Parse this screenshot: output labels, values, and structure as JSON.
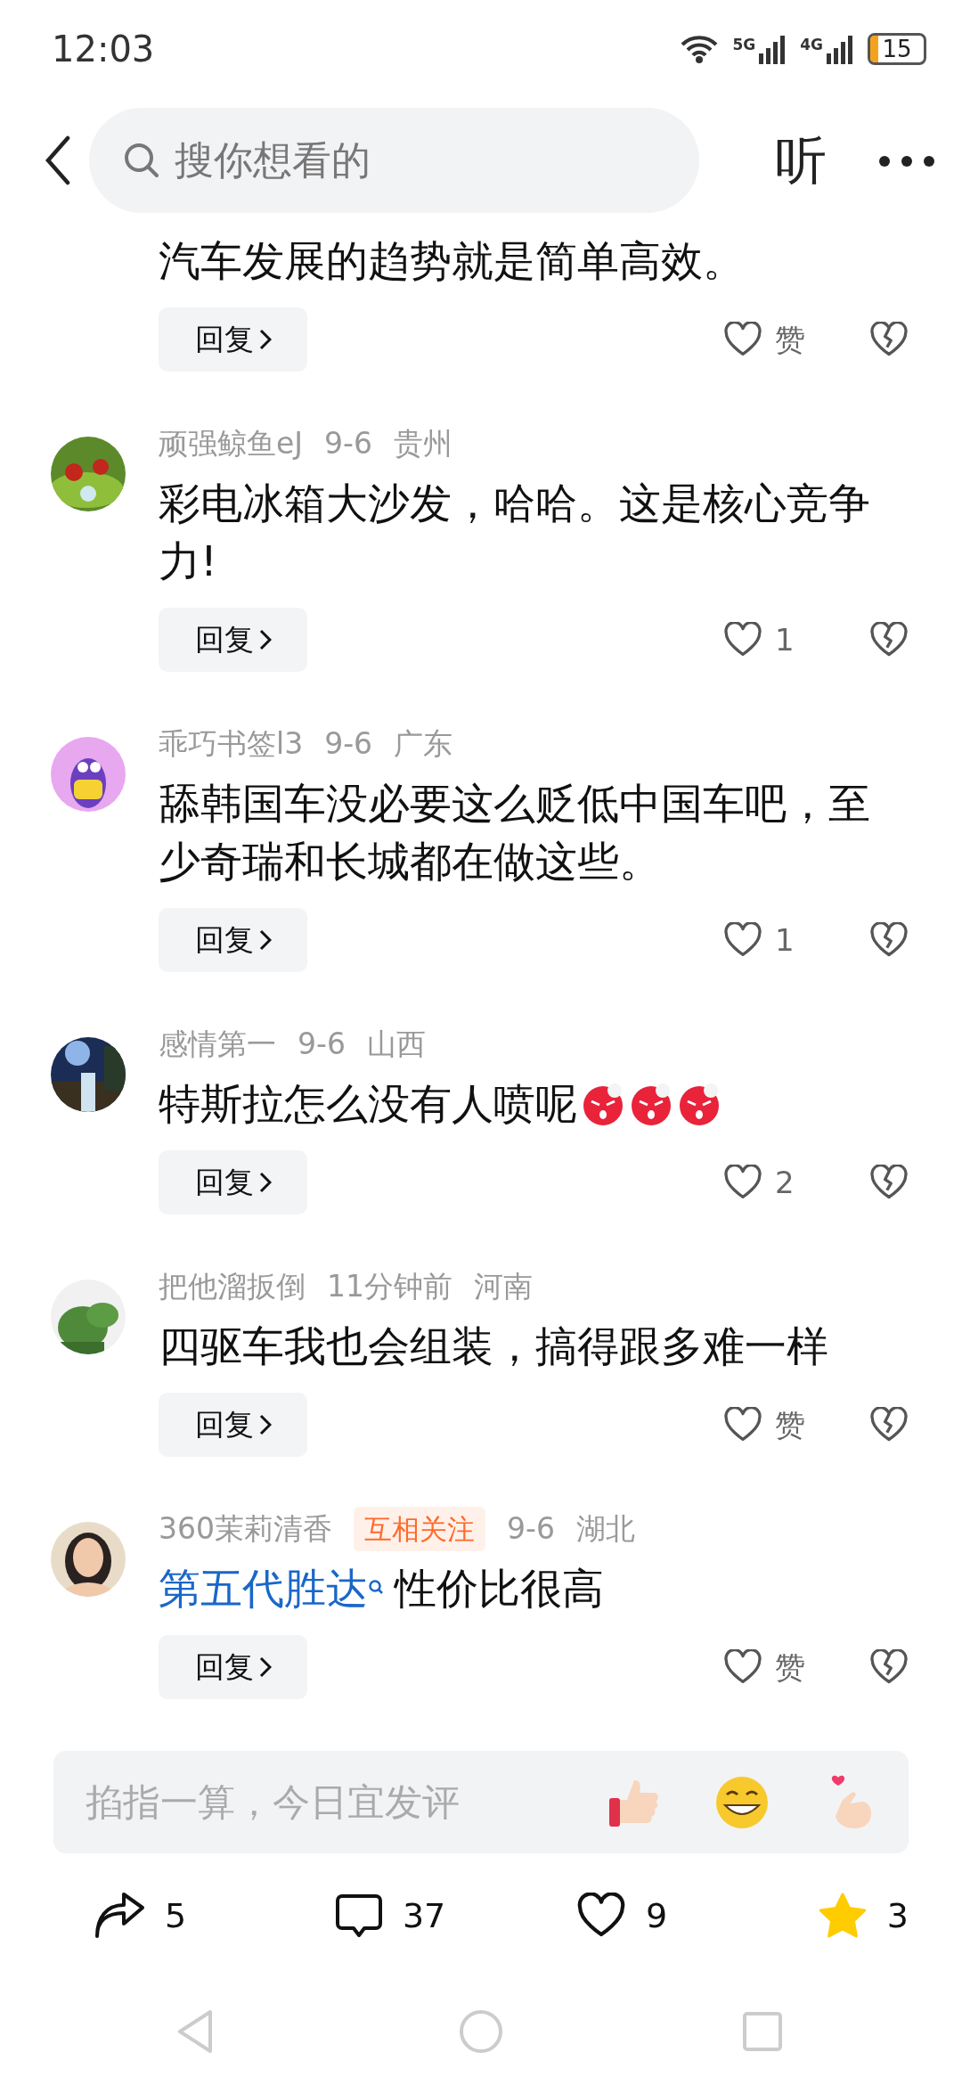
{
  "status_bar": {
    "time": "12:03",
    "networks": [
      "5G",
      "4G"
    ],
    "battery": "15"
  },
  "header": {
    "search_placeholder": "搜你想看的",
    "listen_label": "听"
  },
  "comments": [
    {
      "kind": "plain",
      "text": "汽车发展的趋势就是简单高效。",
      "reply_label": "回复",
      "likes": "赞"
    },
    {
      "kind": "plain",
      "user": "顽强鲸鱼eJ",
      "date": "9-6",
      "region": "贵州",
      "text": "彩电冰箱大沙发，哈哈。这是核心竞争力!",
      "reply_label": "回复",
      "likes": "1"
    },
    {
      "kind": "plain",
      "user": "乖巧书签l3",
      "date": "9-6",
      "region": "广东",
      "text": "舔韩国车没必要这么贬低中国车吧，至少奇瑞和长城都在做这些。",
      "reply_label": "回复",
      "likes": "1"
    },
    {
      "kind": "emoji",
      "user": "感情第一",
      "date": "9-6",
      "region": "山西",
      "text": "特斯拉怎么没有人喷呢",
      "reply_label": "回复",
      "likes": "2"
    },
    {
      "kind": "plain",
      "user": "把他溜扳倒",
      "date": "11分钟前",
      "region": "河南",
      "text": "四驱车我也会组装，搞得跟多难一样",
      "reply_label": "回复",
      "likes": "赞"
    },
    {
      "kind": "link",
      "user": "360茉莉清香",
      "badge": "互相关注",
      "date": "9-6",
      "region": "湖北",
      "link": "第五代胜达",
      "text": "性价比很高",
      "reply_label": "回复",
      "likes": "赞"
    }
  ],
  "comment_box": {
    "placeholder": "掐指一算，今日宜发评"
  },
  "actions": [
    {
      "kind": "share",
      "count": "5",
      "on": false
    },
    {
      "kind": "comment",
      "count": "37",
      "on": false
    },
    {
      "kind": "like",
      "count": "9",
      "on": false
    },
    {
      "kind": "favorite",
      "count": "3",
      "on": true
    }
  ]
}
